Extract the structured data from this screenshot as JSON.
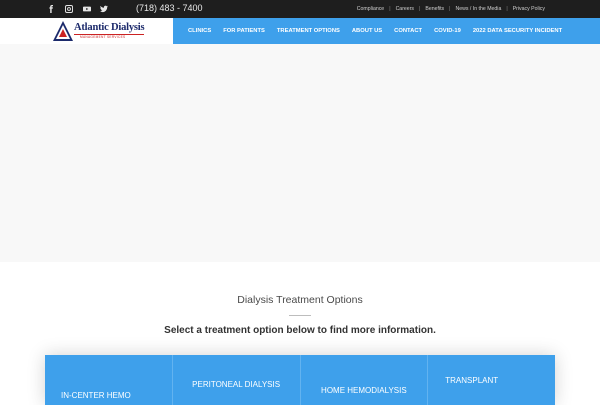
{
  "topbar": {
    "phone": "(718) 483 - 7400",
    "social_icons": [
      "facebook-icon",
      "instagram-icon",
      "youtube-icon",
      "twitter-icon"
    ],
    "links": [
      "Compliance",
      "Careers",
      "Benefits",
      "News / In the Media",
      "Privacy Policy"
    ]
  },
  "logo": {
    "name": "Atlantic Dialysis",
    "sub": "MANAGEMENT SERVICES"
  },
  "nav": {
    "items": [
      "CLINICS",
      "FOR PATIENTS",
      "TREATMENT OPTIONS",
      "ABOUT US",
      "CONTACT",
      "COVID-19",
      "2022 DATA SECURITY INCIDENT"
    ]
  },
  "section": {
    "title": "Dialysis Treatment Options",
    "subtitle": "Select a treatment option below to find more information."
  },
  "options": [
    "IN-CENTER HEMO",
    "PERITONEAL DIALYSIS",
    "HOME HEMODIALYSIS",
    "TRANSPLANT"
  ],
  "colors": {
    "accent": "#3ea0eb",
    "topbar": "#1e1e1e",
    "brand": "#1c2a6b",
    "logo_red": "#cc2222"
  }
}
